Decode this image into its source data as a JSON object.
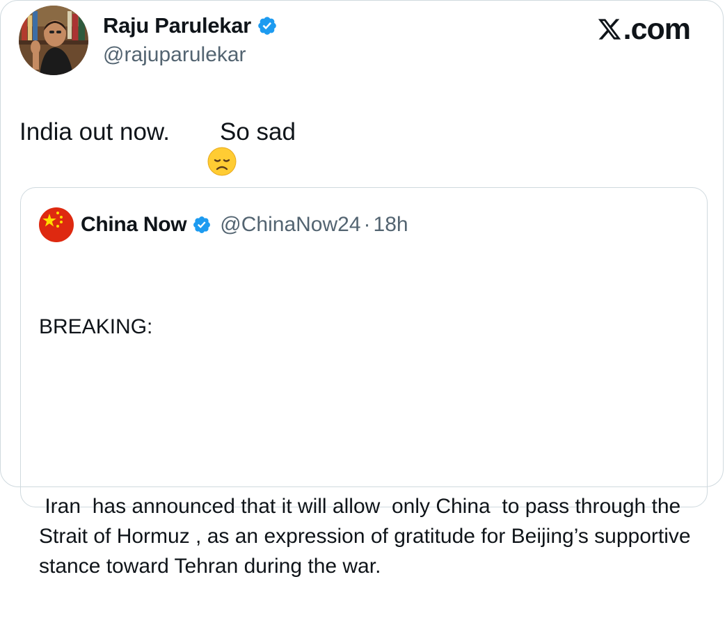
{
  "author": {
    "name": "Raju Parulekar",
    "handle": "@rajuparulekar",
    "verified": true
  },
  "watermark": "𝕏.com",
  "watermark_suffix": ".com",
  "tweet": {
    "text_before": "India out now.",
    "emoji": "disappointed-face-emoji",
    "text_after": "So sad"
  },
  "quoted": {
    "name": "China Now",
    "handle": "@ChinaNow24",
    "separator": "·",
    "time": "18h",
    "verified": true,
    "avatar_icon": "china-flag-icon",
    "body": {
      "line1": "BREAKING:",
      "paragraph": " Iran  has announced that it will allow  only China  to pass through the  Strait of Hormuz , as an expression of gratitude for Beijing’s supportive stance toward Tehran during the war."
    }
  },
  "colors": {
    "text": "#0f1419",
    "muted": "#536471",
    "verified_blue": "#1d9bf0",
    "border": "#cfd9de",
    "flag_red": "#de2910",
    "flag_star": "#ffde00"
  }
}
